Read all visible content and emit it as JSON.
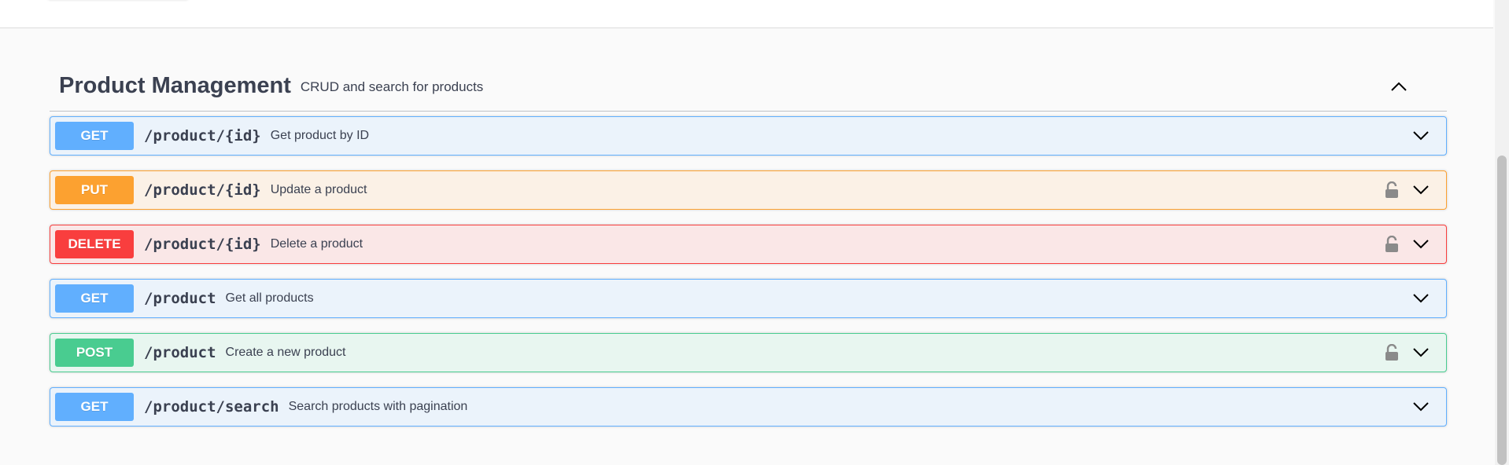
{
  "section": {
    "title": "Product Management",
    "description": "CRUD and search for products",
    "collapse_icon": "chevron-up-icon"
  },
  "operations": [
    {
      "method": "GET",
      "path": "/product/{id}",
      "summary": "Get product by ID",
      "locked": false
    },
    {
      "method": "PUT",
      "path": "/product/{id}",
      "summary": "Update a product",
      "locked": true
    },
    {
      "method": "DELETE",
      "path": "/product/{id}",
      "summary": "Delete a product",
      "locked": true
    },
    {
      "method": "GET",
      "path": "/product",
      "summary": "Get all products",
      "locked": false
    },
    {
      "method": "POST",
      "path": "/product",
      "summary": "Create a new product",
      "locked": true
    },
    {
      "method": "GET",
      "path": "/product/search",
      "summary": "Search products with pagination",
      "locked": false
    }
  ],
  "colors": {
    "get": "#61affe",
    "put": "#fca130",
    "delete": "#f93e3e",
    "post": "#49cc90",
    "text": "#3b4151"
  },
  "icons": {
    "lock": "lock-icon",
    "expand": "chevron-down-icon"
  }
}
